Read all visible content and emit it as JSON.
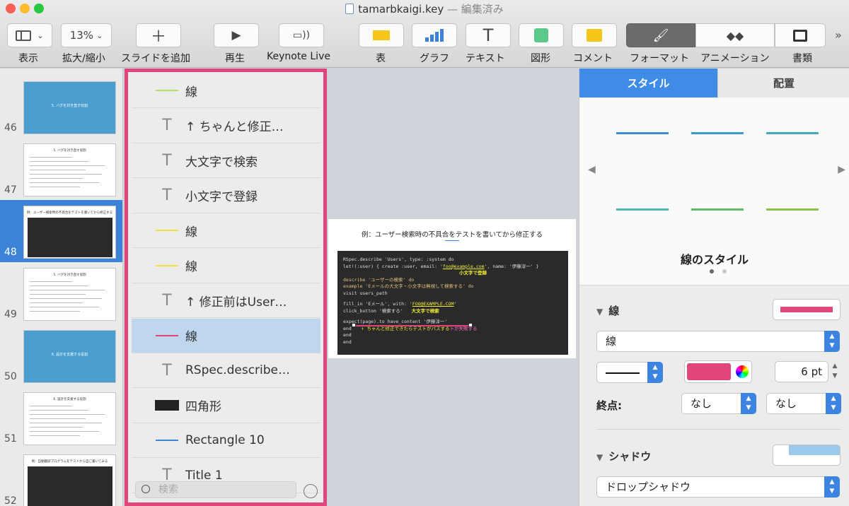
{
  "window": {
    "title": "tamarbkaigi.key",
    "edited": "— 編集済み"
  },
  "toolbar": {
    "view": "表示",
    "zoom_value": "13%",
    "zoom": "拡大/縮小",
    "add_slide": "スライドを追加",
    "play": "再生",
    "keynote_live": "Keynote Live",
    "table": "表",
    "chart": "グラフ",
    "text": "テキスト",
    "shape": "図形",
    "comment": "コメント",
    "format": "フォーマット",
    "animate": "アニメーション",
    "document": "書類",
    "more": "»"
  },
  "slides": [
    {
      "num": "46",
      "kind": "title",
      "title": "5. バグを対き直す収割"
    },
    {
      "num": "47",
      "kind": "text",
      "title": "5. バグを対き直す収割"
    },
    {
      "num": "48",
      "kind": "code",
      "title": "例：ユーザー検索時の不具合をテストを書いてから修正する",
      "selected": true
    },
    {
      "num": "49",
      "kind": "text",
      "title": "5. バグを対き直す収割"
    },
    {
      "num": "50",
      "kind": "title",
      "title": "6. 設計を支援する役割"
    },
    {
      "num": "51",
      "kind": "text",
      "title": "6. 設計を支援する役割"
    },
    {
      "num": "52",
      "kind": "code",
      "title": "例：自動翻訳プログラムをテストから自ご書いてみる"
    }
  ],
  "objects": [
    {
      "type": "line",
      "color": "#b4e05a",
      "label": "線"
    },
    {
      "type": "text",
      "label": "↑ ちゃんと修正…"
    },
    {
      "type": "text",
      "label": "大文字で検索"
    },
    {
      "type": "text",
      "label": "小文字で登録"
    },
    {
      "type": "line",
      "color": "#f0e040",
      "label": "線"
    },
    {
      "type": "line",
      "color": "#f0e040",
      "label": "線"
    },
    {
      "type": "text",
      "label": "↑ 修正前はUser…"
    },
    {
      "type": "line",
      "color": "#e0467b",
      "label": "線",
      "selected": true
    },
    {
      "type": "text",
      "label": "RSpec.describe…"
    },
    {
      "type": "rect",
      "color": "#222222",
      "label": "四角形"
    },
    {
      "type": "line",
      "color": "#3b82d8",
      "label": "Rectangle 10"
    },
    {
      "type": "text",
      "label": "Title 1"
    }
  ],
  "object_search_placeholder": "検索",
  "slide_content": {
    "title": "例：ユーザー検索時の不具合をテストを書いてから修正する",
    "code": {
      "l1": "RSpec.describe 'Users', type: :system do",
      "l2a": "  let!(:user) { create :user, email: '",
      "l2b": "foo@example.com",
      "l2c": "', name: '伊藤淳一' }",
      "n1": "小文字で登録",
      "l3": "  describe 'ユーザーの検索' do",
      "l4": "    example 'Eメールの大文字・小文字は無視して検索する' do",
      "l5": "      visit users_path",
      "l6a": "      fill_in 'Eメール', with: '",
      "l6b": "FOO@EXAMPLE.COM",
      "l6c": "'",
      "l7": "      click_button '検索する'",
      "n2": "大文字で検索",
      "l8": "      expect(page).to have_content '伊藤淳一'",
      "l9": "    end",
      "n3": "↑ ちゃんと修正できたらテストがパスする",
      "n3b": "トが失敗する",
      "l10": "  end",
      "l11": "end"
    }
  },
  "inspector": {
    "tab_style": "スタイル",
    "tab_arrange": "配置",
    "line_styles_label": "線のスタイル",
    "line_section": "線",
    "line_type": "線",
    "line_color": "#e0467b",
    "line_width": "6 pt",
    "endpoint_label": "終点:",
    "endpoint_start": "なし",
    "endpoint_end": "なし",
    "shadow_section": "シャドウ",
    "shadow_type": "ドロップシャドウ"
  }
}
